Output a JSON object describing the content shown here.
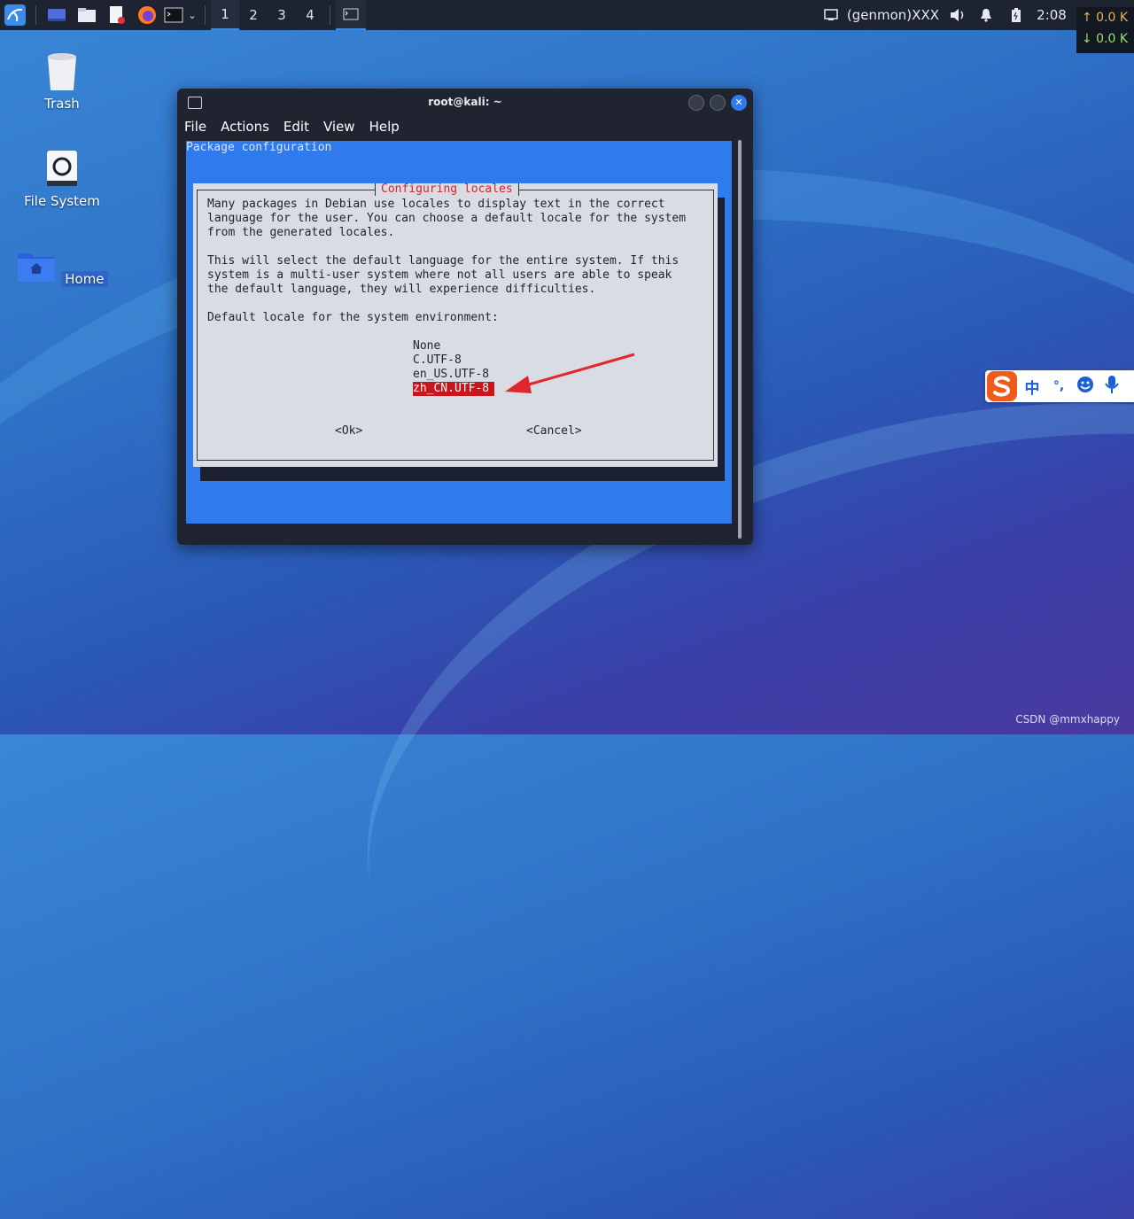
{
  "taskbar": {
    "workspaces": [
      "1",
      "2",
      "3",
      "4"
    ],
    "active_workspace": "1",
    "genmon": "(genmon)XXX",
    "clock": "2:08",
    "net_up": "↑ 0.0 K",
    "net_down": "↓ 0.0 K"
  },
  "desktop": {
    "icons": [
      {
        "label": "Trash"
      },
      {
        "label": "File System"
      },
      {
        "label": "Home"
      }
    ]
  },
  "window": {
    "title": "root@kali: ~",
    "menu": [
      "File",
      "Actions",
      "Edit",
      "View",
      "Help"
    ]
  },
  "terminal": {
    "header": "Package configuration",
    "dialog_title": "Configuring locales",
    "paragraph1": "Many packages in Debian use locales to display text in the correct\nlanguage for the user. You can choose a default locale for the system\nfrom the generated locales.",
    "paragraph2": "This will select the default language for the entire system. If this\nsystem is a multi-user system where not all users are able to speak\nthe default language, they will experience difficulties.",
    "prompt": "Default locale for the system environment:",
    "options": [
      "None",
      "C.UTF-8",
      "en_US.UTF-8",
      "zh_CN.UTF-8"
    ],
    "selected_option": "zh_CN.UTF-8",
    "ok_label": "<Ok>",
    "cancel_label": "<Cancel>"
  },
  "ime": {
    "lang": "中",
    "punct": "°,",
    "emoji_icon": "emoji-icon",
    "mic_icon": "mic-icon"
  },
  "watermark": "CSDN @mmxhappy",
  "colors": {
    "panel": "#1d2330",
    "terminal_bg": "#2f7bec",
    "dialog_bg": "#d9dce2",
    "selection": "#c8161e",
    "arrow": "#e0262e"
  }
}
